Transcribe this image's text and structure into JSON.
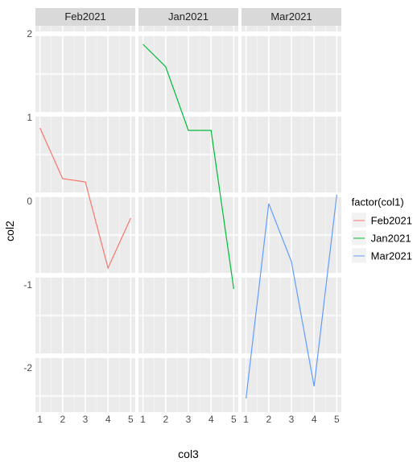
{
  "chart_data": {
    "type": "line",
    "xlabel": "col3",
    "ylabel": "col2",
    "legend_title": "factor(col1)",
    "x": [
      1,
      2,
      3,
      4,
      5
    ],
    "x_ticks": [
      1,
      2,
      3,
      4,
      5
    ],
    "y_ticks": [
      -2,
      -1,
      0,
      1,
      2
    ],
    "xlim": [
      0.8,
      5.2
    ],
    "ylim": [
      -2.7,
      2.1
    ],
    "facets": [
      {
        "label": "Feb2021",
        "series_name": "Feb2021",
        "color": "#F8766D",
        "values": [
          0.83,
          0.2,
          0.16,
          -0.91,
          -0.29
        ]
      },
      {
        "label": "Jan2021",
        "series_name": "Jan2021",
        "color": "#00BA38",
        "values": [
          1.87,
          1.59,
          0.8,
          0.8,
          -1.17
        ]
      },
      {
        "label": "Mar2021",
        "series_name": "Mar2021",
        "color": "#619CFF",
        "values": [
          -2.53,
          -0.11,
          -0.83,
          -2.38,
          0.0
        ]
      }
    ],
    "legend": [
      {
        "label": "Feb2021",
        "color": "#F8766D"
      },
      {
        "label": "Jan2021",
        "color": "#00BA38"
      },
      {
        "label": "Mar2021",
        "color": "#619CFF"
      }
    ]
  }
}
